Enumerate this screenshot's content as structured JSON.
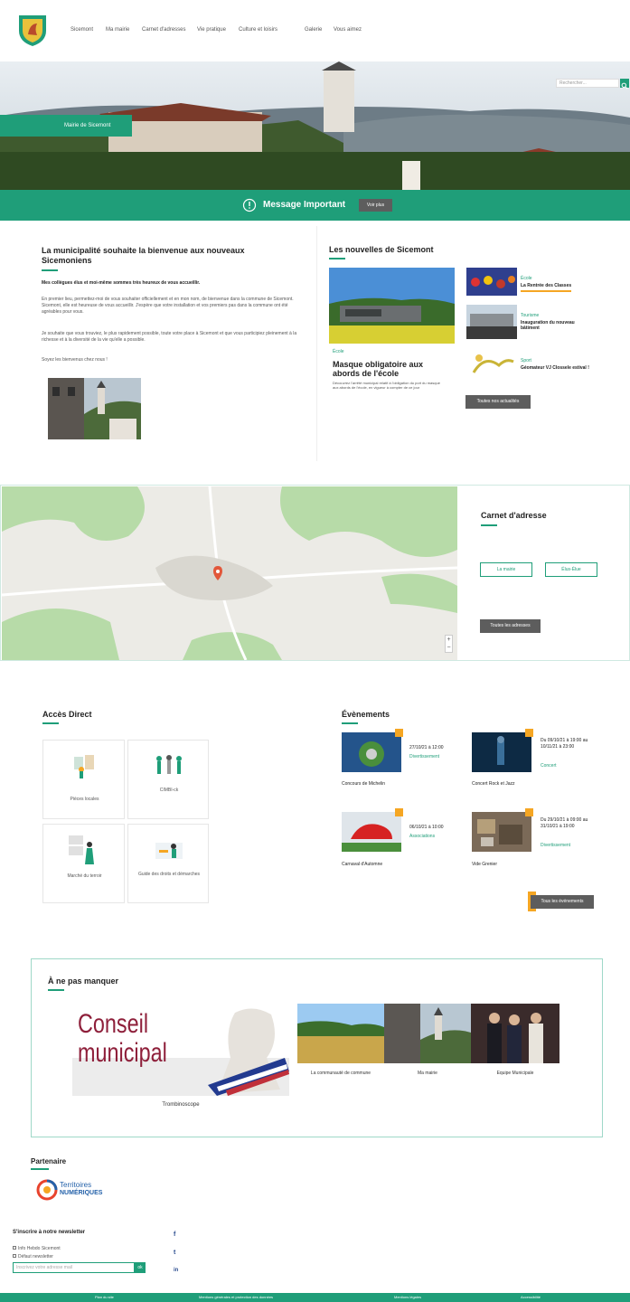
{
  "header": {
    "nav": [
      "Sicemont",
      "Ma mairie",
      "Carnet d'adresses",
      "Vie pratique",
      "Culture et loisirs",
      "Galerie",
      "Vous aimez"
    ]
  },
  "hero": {
    "search_placeholder": "Rechercher...",
    "badge": "Mairie de Sicemont"
  },
  "notice": {
    "title": "Message Important",
    "button": "Voir plus"
  },
  "welcome": {
    "title": "La municipalité souhaite la bienvenue aux nouveaux Sicemoniens",
    "lead": "Mes collègues élus et moi-même sommes très heureux de vous accueillir.",
    "p1": "En premier lieu, permettez-moi de vous souhaiter officiellement et en mon nom, de bienvenue dans la commune de Sicemont. Sicemont, elle est heureuse de vous accueillir. J'espère que votre installation et vos premiers pas dans la commune ont été agréables pour vous.",
    "p2": "Je souhaite que vous trouviez, le plus rapidement possible, toute votre place à Sicemont et que vous participiez pleinement à la richesse et à la diversité de la vie qu'elle a possible.",
    "p3": "Soyez les bienvenus chez nous !"
  },
  "news": {
    "title": "Les nouvelles de Sicemont",
    "main_category": "École",
    "main_title": "Masque obligatoire aux abords de l'école",
    "main_text": "Découvrez l'arrêté municipal relatif à l'obligation du port du masque aux abords de l'école, en vigueur à compter de ce jour",
    "items": [
      {
        "category": "École",
        "title": "La Rentrée des Classes"
      },
      {
        "category": "Tourisme",
        "title": "Inauguration du nouveau bâtiment"
      },
      {
        "category": "Sport",
        "title": "Géomateur VJ Clossele estival !"
      }
    ],
    "all_button": "Toutes nos actualités"
  },
  "address": {
    "title": "Carnet d'adresse",
    "btn1": "La mairie",
    "btn2": "Élus-Élue",
    "all_button": "Toutes les adresses"
  },
  "access": {
    "title": "Accès Direct",
    "tiles": [
      "Pièces locales",
      "CIMBI-ck",
      "Marché du terroir",
      "Guide des droits et démarches"
    ]
  },
  "events": {
    "title": "Évènements",
    "items": [
      {
        "date": "27/10/21 à 12:00",
        "category": "Divertissement",
        "name": "Concours de Michelin"
      },
      {
        "date": "Du 09/10/21 à 19:00 au 10/11/21 à 23:00",
        "category": "Concert",
        "name": "Concert Rock et Jazz"
      },
      {
        "date": "06/10/21 à 10:00",
        "category": "Associations",
        "name": "Carnaval d'Automne"
      },
      {
        "date": "Du 29/10/21 à 09:00 au 31/10/21 à 19:00",
        "category": "Divertissement",
        "name": "Vide Grenier"
      }
    ],
    "all_button": "Tous les événements"
  },
  "dontmiss": {
    "title": "À ne pas manquer",
    "poster_line1": "Conseil",
    "poster_line2": "municipal",
    "poster_caption": "Trombinoscope",
    "items": [
      "La communauté de commune",
      "Ma mairie",
      "Equipe Municipale"
    ]
  },
  "partner": {
    "title": "Partenaire",
    "name_line1": "Territoires",
    "name_line2": "NUMÉRIQUES"
  },
  "newsletter": {
    "title": "S'inscrire à notre newsletter",
    "opt1": "Info Hebdo Sicemont",
    "opt2": "Défaut newsletter",
    "placeholder": "Inscrivez votre adresse mail",
    "submit": "ok"
  },
  "social": [
    "f",
    "t",
    "in"
  ],
  "footer": [
    "Plan du site",
    "Mentions générales et protection des données",
    "Mentions légales",
    "Accessibilité"
  ],
  "colors": {
    "accent": "#1f9e79",
    "button": "#5d5d5d",
    "tag": "#f5a623"
  }
}
